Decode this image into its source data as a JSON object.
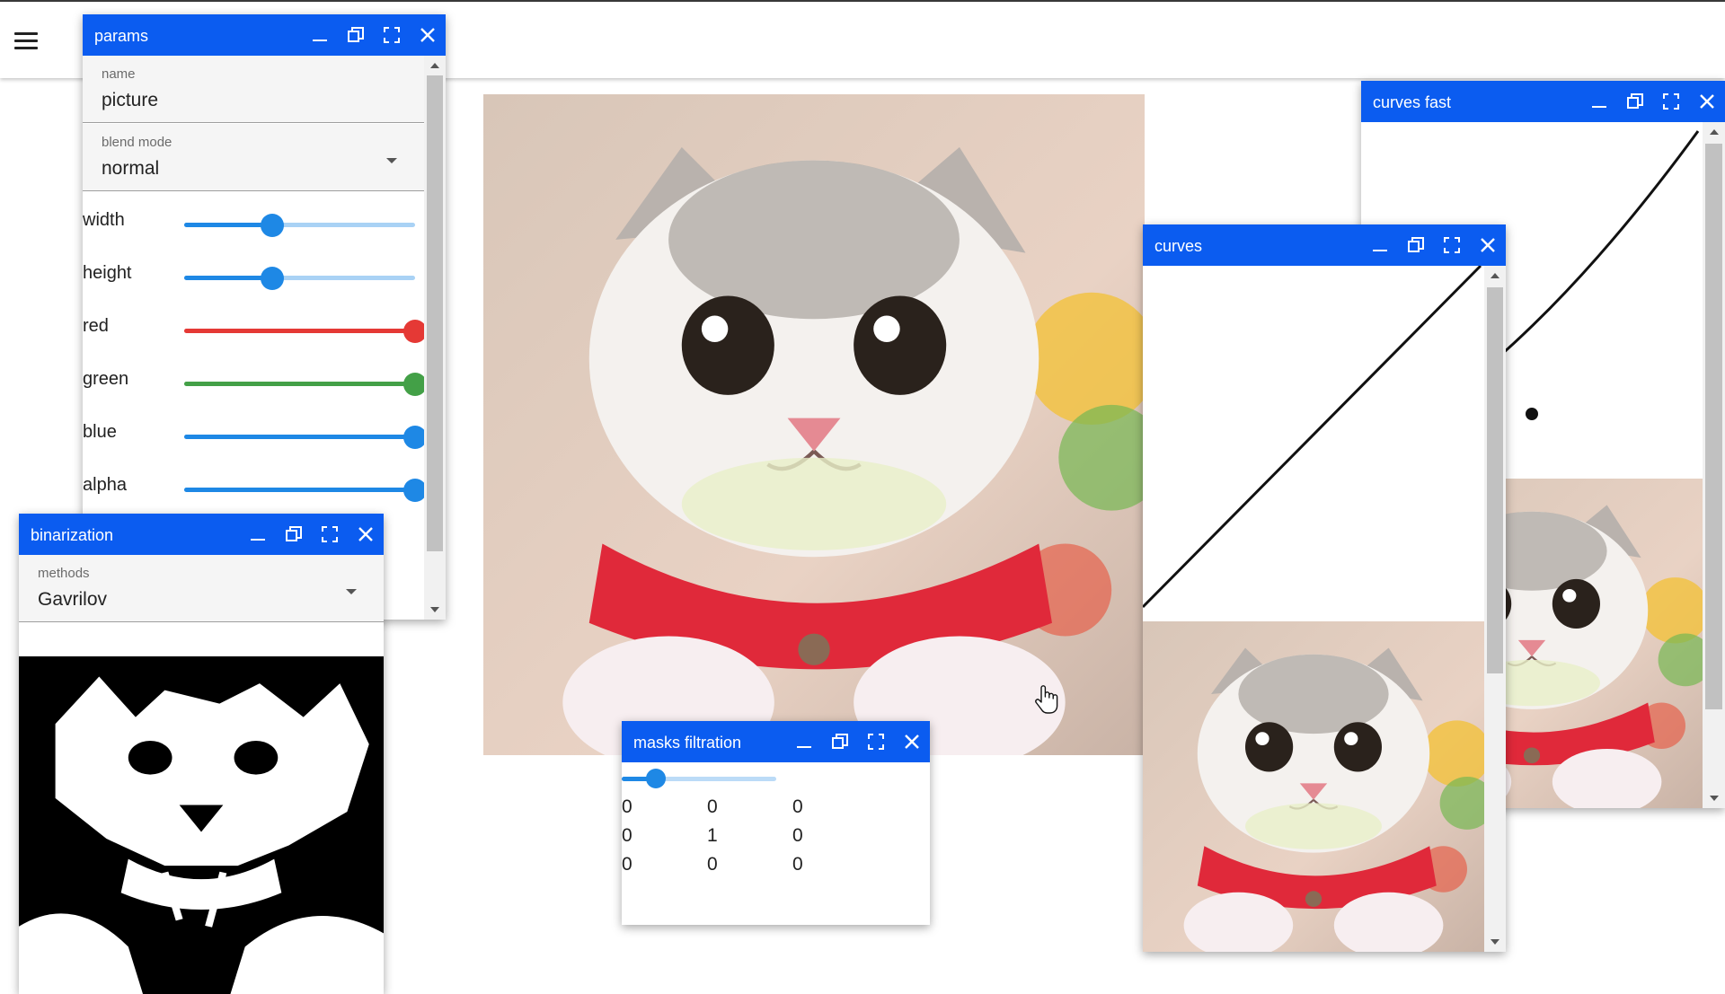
{
  "params": {
    "title": "params",
    "name_label": "name",
    "name_value": "picture",
    "blend_label": "blend mode",
    "blend_value": "normal",
    "sliders": [
      {
        "label": "width",
        "value": 0.38,
        "color": "#1e88e5"
      },
      {
        "label": "height",
        "value": 0.38,
        "color": "#1e88e5"
      },
      {
        "label": "red",
        "value": 1.0,
        "color": "#e53935"
      },
      {
        "label": "green",
        "value": 1.0,
        "color": "#43a047"
      },
      {
        "label": "blue",
        "value": 1.0,
        "color": "#1e88e5"
      },
      {
        "label": "alpha",
        "value": 1.0,
        "color": "#1e88e5"
      }
    ]
  },
  "binarization": {
    "title": "binarization",
    "methods_label": "methods",
    "methods_value": "Gavrilov"
  },
  "masks": {
    "title": "masks filtration",
    "slider_value": 0.22,
    "matrix": [
      [
        "0",
        "0",
        "0"
      ],
      [
        "0",
        "1",
        "0"
      ],
      [
        "0",
        "0",
        "0"
      ]
    ]
  },
  "curves": {
    "title": "curves"
  },
  "curves_fast": {
    "title": "curves fast"
  },
  "colors": {
    "titlebar": "#0b5cf0",
    "accent": "#1e88e5"
  },
  "icons": [
    "menu-icon",
    "minimize-icon",
    "restore-icon",
    "fullscreen-icon",
    "close-icon",
    "cat-photo"
  ]
}
